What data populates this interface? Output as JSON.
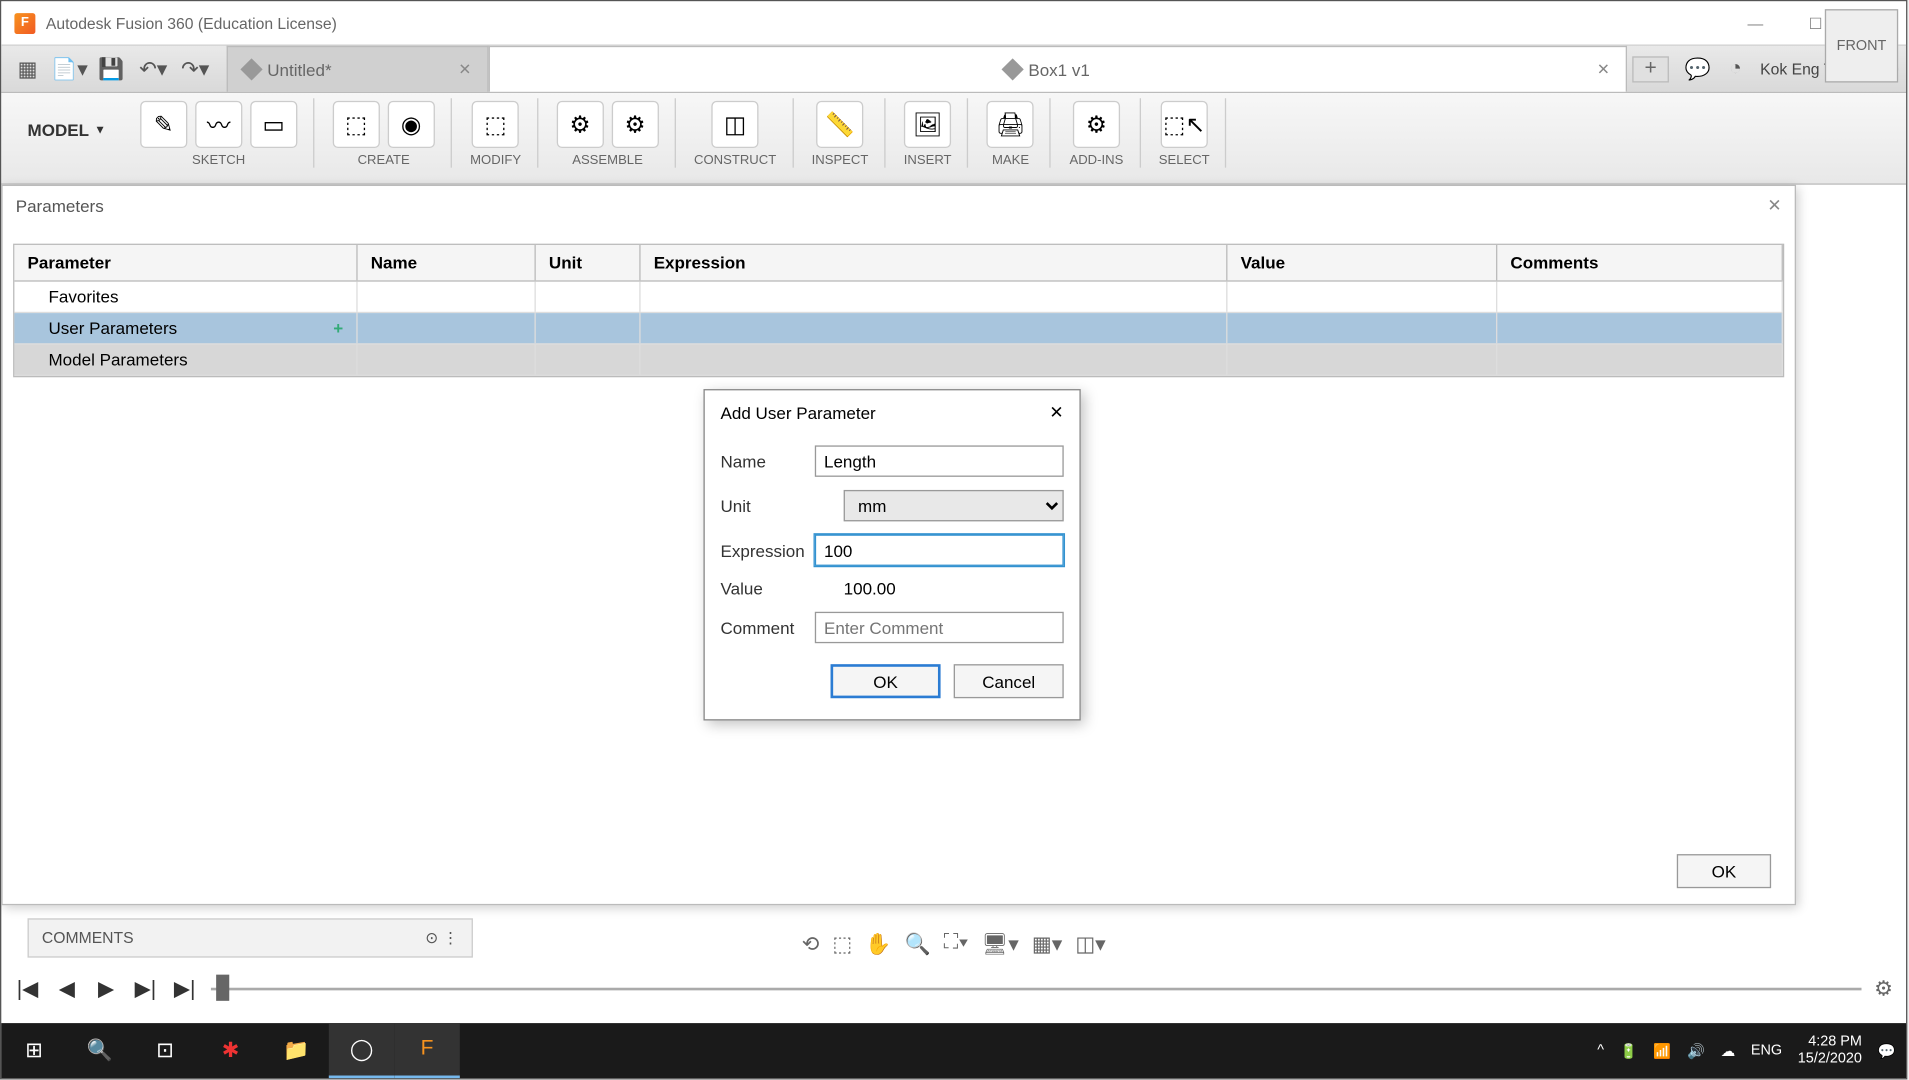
{
  "window": {
    "title": "Autodesk Fusion 360 (Education License)"
  },
  "toprow": {
    "tab1": "Untitled*",
    "tab2": "Box1 v1",
    "username": "Kok Eng Ting"
  },
  "ribbon": {
    "workspace": "MODEL",
    "groups": [
      "SKETCH",
      "CREATE",
      "MODIFY",
      "ASSEMBLE",
      "CONSTRUCT",
      "INSPECT",
      "INSERT",
      "MAKE",
      "ADD-INS",
      "SELECT"
    ]
  },
  "viewcube": {
    "face": "FRONT"
  },
  "params_modal": {
    "title": "Parameters",
    "headers": {
      "parameter": "Parameter",
      "name": "Name",
      "unit": "Unit",
      "expression": "Expression",
      "value": "Value",
      "comments": "Comments"
    },
    "rows": {
      "favorites": "Favorites",
      "user": "User Parameters",
      "model": "Model Parameters"
    },
    "ok": "OK"
  },
  "add_dialog": {
    "title": "Add User Parameter",
    "labels": {
      "name": "Name",
      "unit": "Unit",
      "expression": "Expression",
      "value": "Value",
      "comment": "Comment"
    },
    "values": {
      "name": "Length",
      "unit": "mm",
      "expression": "100",
      "value": "100.00"
    },
    "placeholders": {
      "comment": "Enter Comment"
    },
    "buttons": {
      "ok": "OK",
      "cancel": "Cancel"
    }
  },
  "comments_bar": {
    "label": "COMMENTS"
  },
  "taskbar": {
    "lang": "ENG",
    "time": "4:28 PM",
    "date": "15/2/2020"
  }
}
